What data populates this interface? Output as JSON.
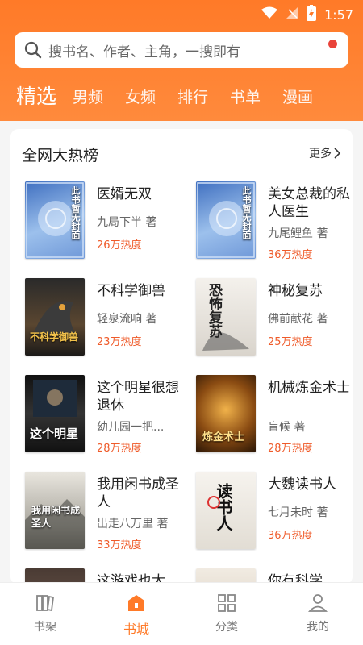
{
  "status": {
    "time": "1:57"
  },
  "search": {
    "placeholder": "搜书名、作者、主角，一搜即有"
  },
  "tabs": [
    "精选",
    "男频",
    "女频",
    "排行",
    "书单",
    "漫画"
  ],
  "section": {
    "title": "全网大热榜",
    "more": "更多"
  },
  "books": [
    {
      "title": "医婿无双",
      "author": "九局下半 著",
      "heat": "26万热度",
      "cover_text": "此书暂无封面"
    },
    {
      "title": "美女总裁的私人医生",
      "author": "九尾鲤鱼 著",
      "heat": "36万热度",
      "cover_text": "此书暂无封面"
    },
    {
      "title": "不科学御兽",
      "author": "轻泉流响 著",
      "heat": "23万热度",
      "cover_text": "不科学御兽"
    },
    {
      "title": "神秘复苏",
      "author": "佛前献花 著",
      "heat": "25万热度",
      "cover_text": "恐怖复苏"
    },
    {
      "title": "这个明星很想退休",
      "author": "幼儿园一把...",
      "heat": "28万热度",
      "cover_text": "这个明星"
    },
    {
      "title": "机械炼金术士",
      "author": "盲候 著",
      "heat": "28万热度",
      "cover_text": "炼金术士"
    },
    {
      "title": "我用闲书成圣人",
      "author": "出走八万里 著",
      "heat": "33万热度",
      "cover_text": "我用闲书成圣人"
    },
    {
      "title": "大魏读书人",
      "author": "七月未时 著",
      "heat": "36万热度",
      "cover_text": "读书人"
    },
    {
      "title": "这游戏也太",
      "author": "",
      "heat": "",
      "cover_text": ""
    },
    {
      "title": "你有科学",
      "author": "",
      "heat": "",
      "cover_text": ""
    }
  ],
  "nav": [
    {
      "label": "书架",
      "icon": "bookshelf-icon"
    },
    {
      "label": "书城",
      "icon": "bookstore-icon"
    },
    {
      "label": "分类",
      "icon": "category-icon"
    },
    {
      "label": "我的",
      "icon": "profile-icon"
    }
  ],
  "colors": {
    "accent": "#ff7a28",
    "heat": "#ef5b2a"
  }
}
